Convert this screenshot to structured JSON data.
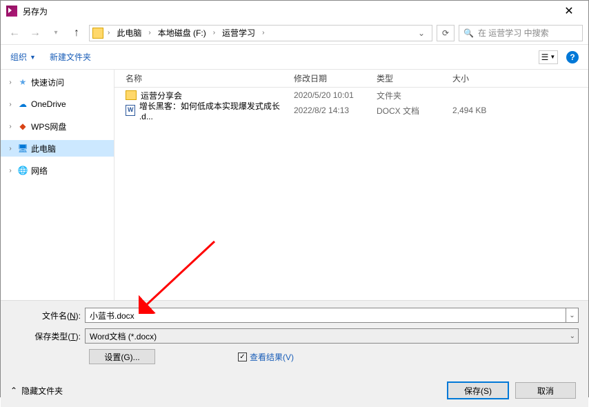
{
  "title": "另存为",
  "path": {
    "items": [
      "此电脑",
      "本地磁盘 (F:)",
      "运营学习"
    ]
  },
  "search_placeholder": "在 运营学习 中搜索",
  "toolbar": {
    "organize": "组织",
    "new_folder": "新建文件夹"
  },
  "sidebar": {
    "items": [
      {
        "label": "快速访问",
        "icon": "star"
      },
      {
        "label": "OneDrive",
        "icon": "cloud"
      },
      {
        "label": "WPS网盘",
        "icon": "wps"
      },
      {
        "label": "此电脑",
        "icon": "pc",
        "selected": true
      },
      {
        "label": "网络",
        "icon": "net"
      }
    ]
  },
  "columns": {
    "name": "名称",
    "date": "修改日期",
    "type": "类型",
    "size": "大小"
  },
  "files": [
    {
      "name": "运营分享会",
      "date": "2020/5/20 10:01",
      "type": "文件夹",
      "size": "",
      "kind": "folder"
    },
    {
      "name": "增长黑客：如何低成本实现爆发式成长 .d...",
      "date": "2022/8/2 14:13",
      "type": "DOCX 文档",
      "size": "2,494 KB",
      "kind": "doc"
    }
  ],
  "form": {
    "filename_label_pre": "文件名(",
    "filename_label_u": "N",
    "filename_label_post": "):",
    "filename_value": "小蓝书.docx",
    "filetype_label_pre": "保存类型(",
    "filetype_label_u": "T",
    "filetype_label_post": "):",
    "filetype_value": "Word文档 (*.docx)",
    "settings_btn": "设置(G)...",
    "view_result": "查看结果(V)"
  },
  "bottom": {
    "hide_folders": "隐藏文件夹",
    "save": "保存(S)",
    "cancel": "取消"
  }
}
